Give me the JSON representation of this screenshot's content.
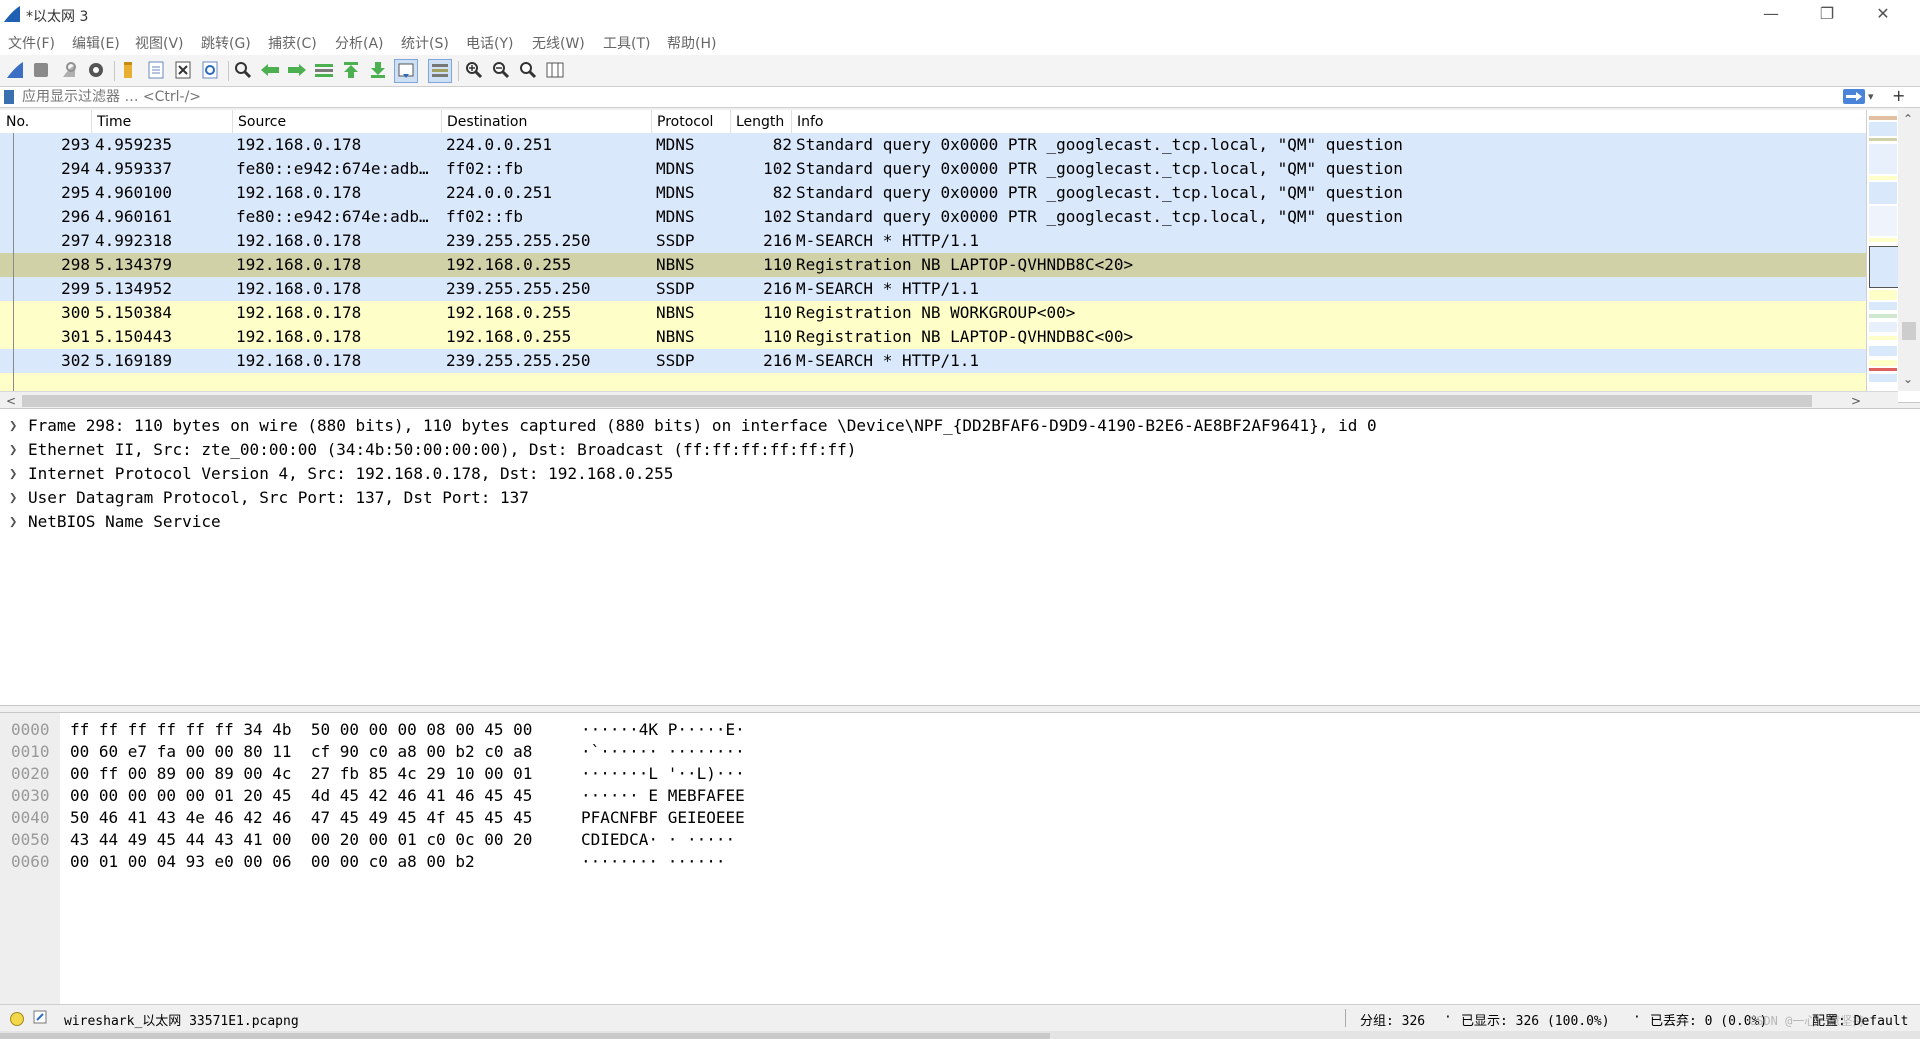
{
  "window": {
    "title": "*以太网 3"
  },
  "menu": [
    "文件(F)",
    "编辑(E)",
    "视图(V)",
    "跳转(G)",
    "捕获(C)",
    "分析(A)",
    "统计(S)",
    "电话(Y)",
    "无线(W)",
    "工具(T)",
    "帮助(H)"
  ],
  "toolbar": {
    "icons": [
      "shark-fin-start-icon",
      "stop-capture-icon",
      "restart-capture-icon",
      "capture-options-icon",
      "open-file-icon",
      "save-file-icon",
      "close-file-icon",
      "reload-icon",
      "find-packet-icon",
      "go-back-icon",
      "go-forward-icon",
      "go-to-packet-icon",
      "first-packet-icon",
      "last-packet-icon",
      "auto-scroll-icon",
      "colorize-icon",
      "zoom-in-icon",
      "zoom-out-icon",
      "normal-size-icon",
      "resize-columns-icon"
    ]
  },
  "filter": {
    "placeholder": "应用显示过滤器 … <Ctrl-/>"
  },
  "packet_list": {
    "columns": [
      "No.",
      "Time",
      "Source",
      "Destination",
      "Protocol",
      "Length",
      "Info"
    ],
    "rows": [
      {
        "no": "293",
        "time": "4.959235",
        "src": "192.168.0.178",
        "dst": "224.0.0.251",
        "proto": "MDNS",
        "len": "82",
        "info": "Standard query 0x0000 PTR _googlecast._tcp.local, \"QM\" question",
        "bg": "#dae8fc"
      },
      {
        "no": "294",
        "time": "4.959337",
        "src": "fe80::e942:674e:adb…",
        "dst": "ff02::fb",
        "proto": "MDNS",
        "len": "102",
        "info": "Standard query 0x0000 PTR _googlecast._tcp.local, \"QM\" question",
        "bg": "#dae8fc"
      },
      {
        "no": "295",
        "time": "4.960100",
        "src": "192.168.0.178",
        "dst": "224.0.0.251",
        "proto": "MDNS",
        "len": "82",
        "info": "Standard query 0x0000 PTR _googlecast._tcp.local, \"QM\" question",
        "bg": "#dae8fc"
      },
      {
        "no": "296",
        "time": "4.960161",
        "src": "fe80::e942:674e:adb…",
        "dst": "ff02::fb",
        "proto": "MDNS",
        "len": "102",
        "info": "Standard query 0x0000 PTR _googlecast._tcp.local, \"QM\" question",
        "bg": "#dae8fc"
      },
      {
        "no": "297",
        "time": "4.992318",
        "src": "192.168.0.178",
        "dst": "239.255.255.250",
        "proto": "SSDP",
        "len": "216",
        "info": "M-SEARCH * HTTP/1.1",
        "bg": "#dae8fc"
      },
      {
        "no": "298",
        "time": "5.134379",
        "src": "192.168.0.178",
        "dst": "192.168.0.255",
        "proto": "NBNS",
        "len": "110",
        "info": "Registration NB LAPTOP-QVHNDB8C<20>",
        "bg": "#d1d1a8"
      },
      {
        "no": "299",
        "time": "5.134952",
        "src": "192.168.0.178",
        "dst": "239.255.255.250",
        "proto": "SSDP",
        "len": "216",
        "info": "M-SEARCH * HTTP/1.1",
        "bg": "#dae8fc"
      },
      {
        "no": "300",
        "time": "5.150384",
        "src": "192.168.0.178",
        "dst": "192.168.0.255",
        "proto": "NBNS",
        "len": "110",
        "info": "Registration NB WORKGROUP<00>",
        "bg": "#fefec8"
      },
      {
        "no": "301",
        "time": "5.150443",
        "src": "192.168.0.178",
        "dst": "192.168.0.255",
        "proto": "NBNS",
        "len": "110",
        "info": "Registration NB LAPTOP-QVHNDB8C<00>",
        "bg": "#fefec8"
      },
      {
        "no": "302",
        "time": "5.169189",
        "src": "192.168.0.178",
        "dst": "239.255.255.250",
        "proto": "SSDP",
        "len": "216",
        "info": "M-SEARCH * HTTP/1.1",
        "bg": "#dae8fc"
      },
      {
        "no": "",
        "time": "",
        "src": "",
        "dst": "",
        "proto": "",
        "len": "",
        "info": "",
        "bg": "#fefec8"
      }
    ]
  },
  "details": [
    "Frame 298: 110 bytes on wire (880 bits), 110 bytes captured (880 bits) on interface \\Device\\NPF_{DD2BFAF6-D9D9-4190-B2E6-AE8BF2AF9641}, id 0",
    "Ethernet II, Src: zte_00:00:00 (34:4b:50:00:00:00), Dst: Broadcast (ff:ff:ff:ff:ff:ff)",
    "Internet Protocol Version 4, Src: 192.168.0.178, Dst: 192.168.0.255",
    "User Datagram Protocol, Src Port: 137, Dst Port: 137",
    "NetBIOS Name Service"
  ],
  "bytes": [
    {
      "offset": "0000",
      "hex": "ff ff ff ff ff ff 34 4b  50 00 00 00 08 00 45 00",
      "ascii": "······4K P·····E·"
    },
    {
      "offset": "0010",
      "hex": "00 60 e7 fa 00 00 80 11  cf 90 c0 a8 00 b2 c0 a8",
      "ascii": "·`······ ········"
    },
    {
      "offset": "0020",
      "hex": "00 ff 00 89 00 89 00 4c  27 fb 85 4c 29 10 00 01",
      "ascii": "·······L '··L)···"
    },
    {
      "offset": "0030",
      "hex": "00 00 00 00 00 01 20 45  4d 45 42 46 41 46 45 45",
      "ascii": "······ E MEBFAFEE"
    },
    {
      "offset": "0040",
      "hex": "50 46 41 43 4e 46 42 46  47 45 49 45 4f 45 45 45",
      "ascii": "PFACNFBF GEIEOEEE"
    },
    {
      "offset": "0050",
      "hex": "43 44 49 45 44 43 41 00  00 20 00 01 c0 0c 00 20",
      "ascii": "CDIEDCA· · ····· "
    },
    {
      "offset": "0060",
      "hex": "00 01 00 04 93 e0 00 06  00 00 c0 a8 00 b2",
      "ascii": "········ ······"
    }
  ],
  "status": {
    "file": "wireshark_以太网 33571E1.pcapng",
    "packets": "分组: 326",
    "displayed": "已显示: 326 (100.0%)",
    "dropped": "已丢弃: 0 (0.0%)",
    "profile": "配置: Default",
    "watermark": "CSDN @一心一意坚持"
  }
}
